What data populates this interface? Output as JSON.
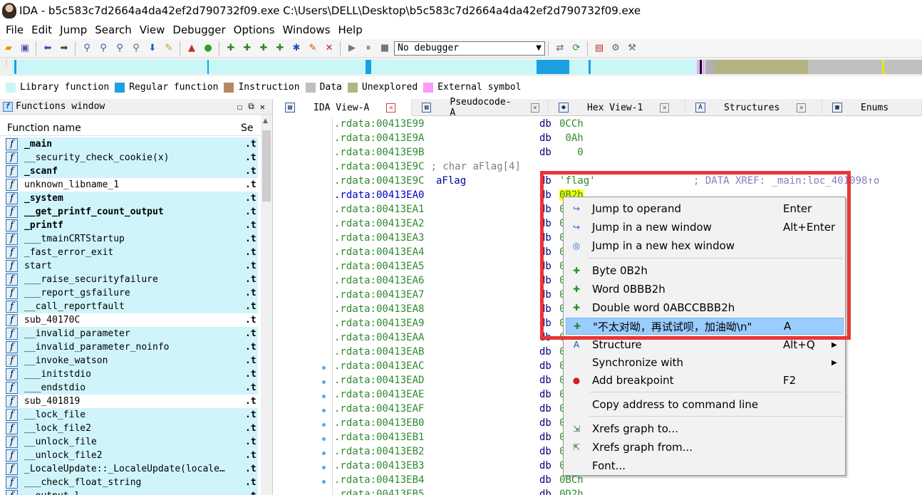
{
  "window": {
    "title": "IDA - b5c583c7d2664a4da42ef2d790732f09.exe C:\\Users\\DELL\\Desktop\\b5c583c7d2664a4da42ef2d790732f09.exe"
  },
  "menu": [
    "File",
    "Edit",
    "Jump",
    "Search",
    "View",
    "Debugger",
    "Options",
    "Windows",
    "Help"
  ],
  "toolbar": {
    "debugger_select": "No debugger"
  },
  "legend": [
    {
      "label": "Library function",
      "color": "#c9f7f7"
    },
    {
      "label": "Regular function",
      "color": "#1ba1e2"
    },
    {
      "label": "Instruction",
      "color": "#b88860"
    },
    {
      "label": "Data",
      "color": "#c0c0c0"
    },
    {
      "label": "Unexplored",
      "color": "#b4b482"
    },
    {
      "label": "External symbol",
      "color": "#ff9bff"
    }
  ],
  "functions_window": {
    "title": "Functions window",
    "col_name": "Function name",
    "col_seg": "Se",
    "items": [
      {
        "name": "_main",
        "seg": ".t",
        "bold": true
      },
      {
        "name": "__security_check_cookie(x)",
        "seg": ".t",
        "bold": false
      },
      {
        "name": "_scanf",
        "seg": ".t",
        "bold": true
      },
      {
        "name": "unknown_libname_1",
        "seg": ".t",
        "bold": false,
        "white": true
      },
      {
        "name": "_system",
        "seg": ".t",
        "bold": true
      },
      {
        "name": "__get_printf_count_output",
        "seg": ".t",
        "bold": true
      },
      {
        "name": "_printf",
        "seg": ".t",
        "bold": true
      },
      {
        "name": "___tmainCRTStartup",
        "seg": ".t",
        "bold": false
      },
      {
        "name": "_fast_error_exit",
        "seg": ".t",
        "bold": false
      },
      {
        "name": "start",
        "seg": ".t",
        "bold": false
      },
      {
        "name": "___raise_securityfailure",
        "seg": ".t",
        "bold": false
      },
      {
        "name": "___report_gsfailure",
        "seg": ".t",
        "bold": false
      },
      {
        "name": "__call_reportfault",
        "seg": ".t",
        "bold": false
      },
      {
        "name": "sub_40170C",
        "seg": ".t",
        "bold": false,
        "white": true
      },
      {
        "name": "__invalid_parameter",
        "seg": ".t",
        "bold": false
      },
      {
        "name": "__invalid_parameter_noinfo",
        "seg": ".t",
        "bold": false
      },
      {
        "name": "__invoke_watson",
        "seg": ".t",
        "bold": false
      },
      {
        "name": "___initstdio",
        "seg": ".t",
        "bold": false
      },
      {
        "name": "___endstdio",
        "seg": ".t",
        "bold": false
      },
      {
        "name": "sub_401819",
        "seg": ".t",
        "bold": false,
        "white": true
      },
      {
        "name": "__lock_file",
        "seg": ".t",
        "bold": false
      },
      {
        "name": "__lock_file2",
        "seg": ".t",
        "bold": false
      },
      {
        "name": "__unlock_file",
        "seg": ".t",
        "bold": false
      },
      {
        "name": "__unlock_file2",
        "seg": ".t",
        "bold": false
      },
      {
        "name": "_LocaleUpdate::_LocaleUpdate(locale…",
        "seg": ".t",
        "bold": false
      },
      {
        "name": "___check_float_string",
        "seg": ".t",
        "bold": false
      },
      {
        "name": "__output_l",
        "seg": ".t",
        "bold": false
      }
    ]
  },
  "tabs": [
    {
      "label": "IDA View-A",
      "icon": "ida-view-icon",
      "active": true
    },
    {
      "label": "Pseudocode-A",
      "icon": "pseudocode-icon",
      "active": false
    },
    {
      "label": "Hex View-1",
      "icon": "hex-view-icon",
      "active": false
    },
    {
      "label": "Structures",
      "icon": "structures-icon",
      "active": false
    },
    {
      "label": "Enums",
      "icon": "enums-icon",
      "active": false
    }
  ],
  "code": {
    "lines": [
      {
        "addr": ".rdata:00413E99",
        "mn": "db",
        "op": "0CCh"
      },
      {
        "addr": ".rdata:00413E9A",
        "mn": "db",
        "op": " 0Ah"
      },
      {
        "addr": ".rdata:00413E9B",
        "mn": "db",
        "op": "   0"
      },
      {
        "addr": ".rdata:00413E9C",
        "comment": "; char aFlag[4]"
      },
      {
        "addr": ".rdata:00413E9C",
        "label": "aFlag",
        "mn": "db",
        "op": "'flag'",
        "xref": "; DATA XREF: _main:loc_401098↑o"
      },
      {
        "addr": ".rdata:00413EA0",
        "mn": "db",
        "op": "0B2h",
        "current": true
      },
      {
        "addr": ".rdata:00413EA1",
        "mn": "db",
        "op": "0"
      },
      {
        "addr": ".rdata:00413EA2",
        "mn": "db",
        "op": "0"
      },
      {
        "addr": ".rdata:00413EA3",
        "mn": "db",
        "op": "0"
      },
      {
        "addr": ".rdata:00413EA4",
        "mn": "db",
        "op": "0"
      },
      {
        "addr": ".rdata:00413EA5",
        "mn": "db",
        "op": "0"
      },
      {
        "addr": ".rdata:00413EA6",
        "mn": "db",
        "op": "0"
      },
      {
        "addr": ".rdata:00413EA7",
        "mn": "db",
        "op": "0"
      },
      {
        "addr": ".rdata:00413EA8",
        "mn": "db",
        "op": "0"
      },
      {
        "addr": ".rdata:00413EA9",
        "mn": "db",
        "op": "0"
      },
      {
        "addr": ".rdata:00413EAA",
        "mn": "db",
        "op": "0"
      },
      {
        "addr": ".rdata:00413EAB",
        "mn": "db",
        "op": "0"
      },
      {
        "addr": ".rdata:00413EAC",
        "mn": "db",
        "op": "0"
      },
      {
        "addr": ".rdata:00413EAD",
        "mn": "db",
        "op": "0"
      },
      {
        "addr": ".rdata:00413EAE",
        "mn": "db",
        "op": "0"
      },
      {
        "addr": ".rdata:00413EAF",
        "mn": "db",
        "op": "0"
      },
      {
        "addr": ".rdata:00413EB0",
        "mn": "db",
        "op": "0"
      },
      {
        "addr": ".rdata:00413EB1",
        "mn": "db",
        "op": "0"
      },
      {
        "addr": ".rdata:00413EB2",
        "mn": "db",
        "op": "0"
      },
      {
        "addr": ".rdata:00413EB3",
        "mn": "db",
        "op": "0"
      },
      {
        "addr": ".rdata:00413EB4",
        "mn": "db",
        "op": "0BCh"
      },
      {
        "addr": ".rdata:00413EB5",
        "mn": "db",
        "op": "0D2h"
      }
    ]
  },
  "context_menu": {
    "items": [
      {
        "label": "Jump to operand",
        "shortcut": "Enter",
        "icon": "jump-arrow-icon"
      },
      {
        "label": "Jump in a new window",
        "shortcut": "Alt+Enter",
        "icon": "jump-window-icon"
      },
      {
        "label": "Jump in a new hex window",
        "shortcut": "",
        "icon": "jump-hex-icon"
      },
      {
        "label": "Byte 0B2h",
        "shortcut": "",
        "icon": "data-byte-icon"
      },
      {
        "label": "Word 0BBB2h",
        "shortcut": "",
        "icon": "data-word-icon"
      },
      {
        "label": "Double word 0ABCCBBB2h",
        "shortcut": "",
        "icon": "data-dword-icon"
      },
      {
        "label": "\"不太对呦，再试试呗，加油呦\\n\"",
        "shortcut": "A",
        "icon": "string-icon",
        "highlighted": true
      },
      {
        "label": "Structure",
        "shortcut": "Alt+Q",
        "icon": "structure-icon",
        "submenu": true
      },
      {
        "label": "Synchronize with",
        "shortcut": "",
        "icon": "",
        "submenu": true
      },
      {
        "label": "Add breakpoint",
        "shortcut": "F2",
        "icon": "breakpoint-icon"
      },
      {
        "label": "Copy address to command line",
        "shortcut": "",
        "icon": ""
      },
      {
        "label": "Xrefs graph to...",
        "shortcut": "",
        "icon": "xrefs-to-icon"
      },
      {
        "label": "Xrefs graph from...",
        "shortcut": "",
        "icon": "xrefs-from-icon"
      },
      {
        "label": "Font...",
        "shortcut": "",
        "icon": ""
      }
    ]
  }
}
